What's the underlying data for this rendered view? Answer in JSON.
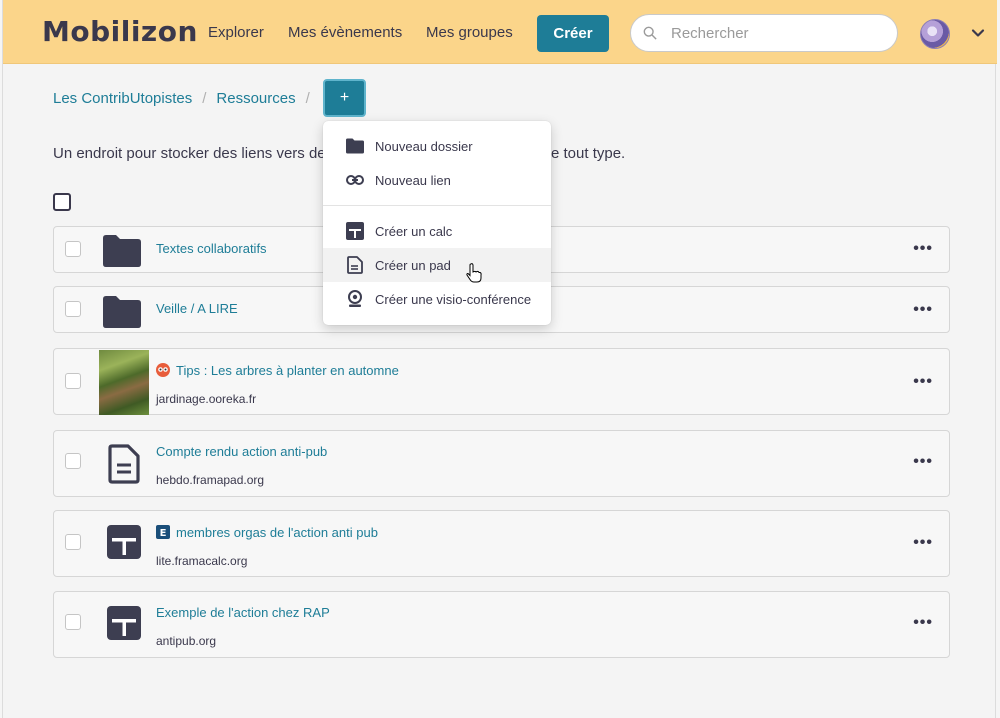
{
  "brand": "Mobilizon",
  "nav": {
    "explorer": "Explorer",
    "my_events": "Mes évènements",
    "my_groups": "Mes groupes",
    "create": "Créer"
  },
  "search": {
    "placeholder": "Rechercher",
    "value": ""
  },
  "breadcrumb": {
    "group": "Les ContribUtopistes",
    "resources": "Ressources",
    "separator": "/",
    "add": "+"
  },
  "intro": {
    "start": "Un endroit pour stocker des liens vers de",
    "end": "e tout type."
  },
  "menu": {
    "new_folder": "Nouveau dossier",
    "new_link": "Nouveau lien",
    "create_calc": "Créer un calc",
    "create_pad": "Créer un pad",
    "create_visio": "Créer une visio-conférence"
  },
  "resources": [
    {
      "title": "Textes collaboratifs",
      "url": "",
      "type": "folder-icon"
    },
    {
      "title": "Veille / A LIRE",
      "url": "",
      "type": "folder-icon"
    },
    {
      "title": "Tips : Les arbres à planter en automne",
      "url": "jardinage.ooreka.fr",
      "type": "image-thumbnail"
    },
    {
      "title": "Compte rendu action anti-pub",
      "url": "hebdo.framapad.org",
      "type": "pad-icon"
    },
    {
      "title": "membres orgas de l'action anti pub",
      "url": "lite.framacalc.org",
      "type": "calc-icon"
    },
    {
      "title": "Exemple de l'action chez RAP",
      "url": "antipub.org",
      "type": "calc-icon"
    }
  ],
  "more_label": "•••",
  "colors": {
    "navbar": "#fbd58a",
    "primary": "#1e7d97",
    "text": "#3a384c"
  }
}
